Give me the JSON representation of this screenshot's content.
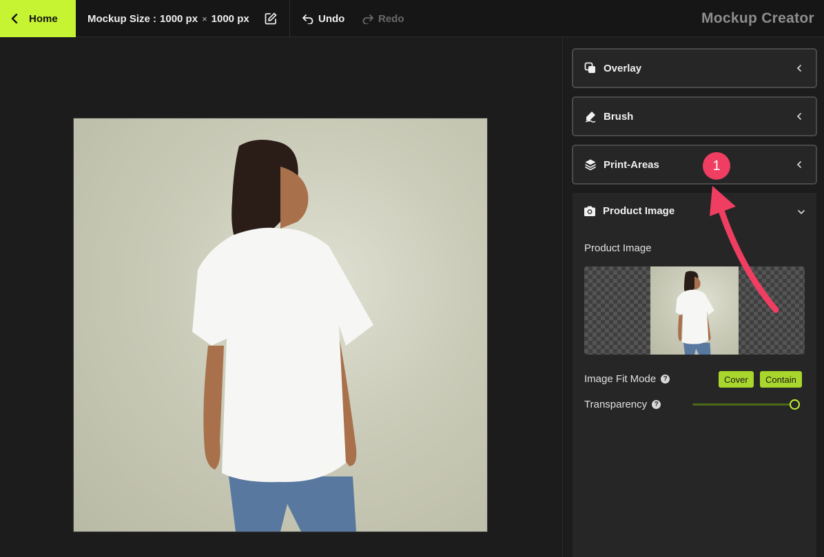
{
  "topbar": {
    "home_label": "Home",
    "size_prefix": "Mockup Size :",
    "width": "1000 px",
    "times": "×",
    "height": "1000 px",
    "undo_label": "Undo",
    "redo_label": "Redo",
    "app_title": "Mockup Creator"
  },
  "sidebar": {
    "sections": {
      "overlay": "Overlay",
      "brush": "Brush",
      "print_areas": "Print-Areas",
      "product_image": "Product Image"
    },
    "product_image": {
      "field_label": "Product Image",
      "fit_mode_label": "Image Fit Mode",
      "fit_options": [
        "Cover",
        "Contain"
      ],
      "transparency_label": "Transparency",
      "transparency_value": 1.0
    }
  },
  "annotation": {
    "badge": "1"
  },
  "colors": {
    "accent": "#c6f432",
    "badge": "#ef3e61",
    "background": "#1c1c1c"
  }
}
